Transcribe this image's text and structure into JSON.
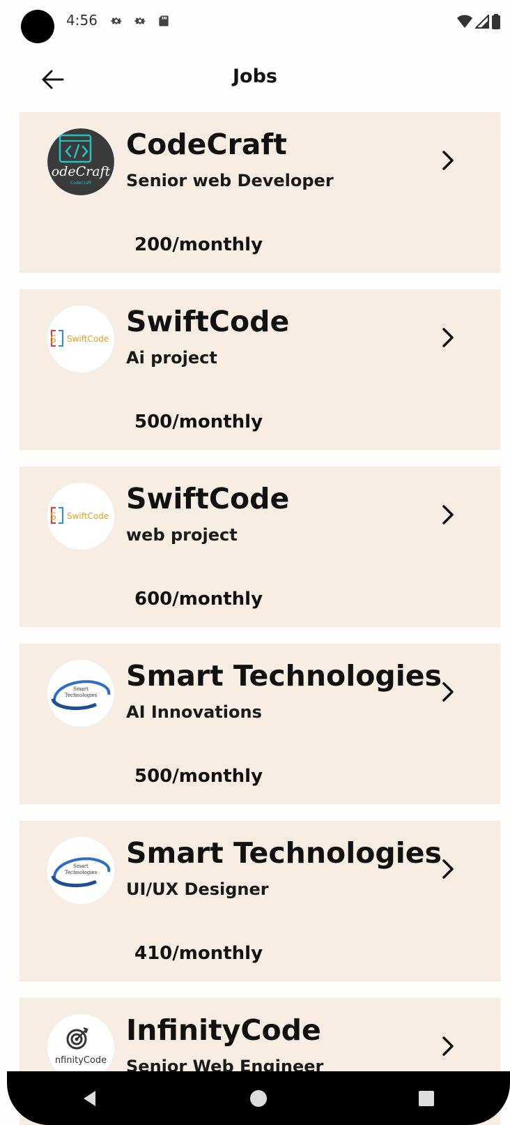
{
  "status_bar": {
    "time": "4:56",
    "left_icons": [
      "gear-icon",
      "gear-icon",
      "sd-card-icon"
    ],
    "right_icons": [
      "wifi-icon",
      "signal-icon",
      "battery-icon"
    ]
  },
  "header": {
    "title": "Jobs",
    "back_icon": "arrow-left-icon"
  },
  "jobs": [
    {
      "company": "CodeCraft",
      "role": "Senior web Developer",
      "salary": "200/monthly",
      "logo": "codecraft-logo",
      "logo_text": "CodeCraft"
    },
    {
      "company": "SwiftCode",
      "role": "Ai project",
      "salary": "500/monthly",
      "logo": "swiftcode-logo",
      "logo_text": "SwiftCode"
    },
    {
      "company": "SwiftCode",
      "role": "web project",
      "salary": "600/monthly",
      "logo": "swiftcode-logo",
      "logo_text": "SwiftCode"
    },
    {
      "company": "Smart Technologies",
      "role": "AI Innovations",
      "salary": "500/monthly",
      "logo": "smart-technologies-logo",
      "logo_text": "Smart Technologies"
    },
    {
      "company": "Smart Technologies",
      "role": "UI/UX Designer",
      "salary": "410/monthly",
      "logo": "smart-technologies-logo",
      "logo_text": "Smart Technologies"
    },
    {
      "company": "InfinityCode",
      "role": "Senior Web Engineer",
      "salary": "",
      "logo": "infinitycode-logo",
      "logo_text": "InfinityCode"
    }
  ],
  "nav_bar": {
    "icons": [
      "back-triangle-icon",
      "home-circle-icon",
      "recents-square-icon"
    ]
  },
  "colors": {
    "card_background": "#f7ede3",
    "page_background": "#fffefc",
    "text": "#111111",
    "nav_bar": "#000000"
  }
}
